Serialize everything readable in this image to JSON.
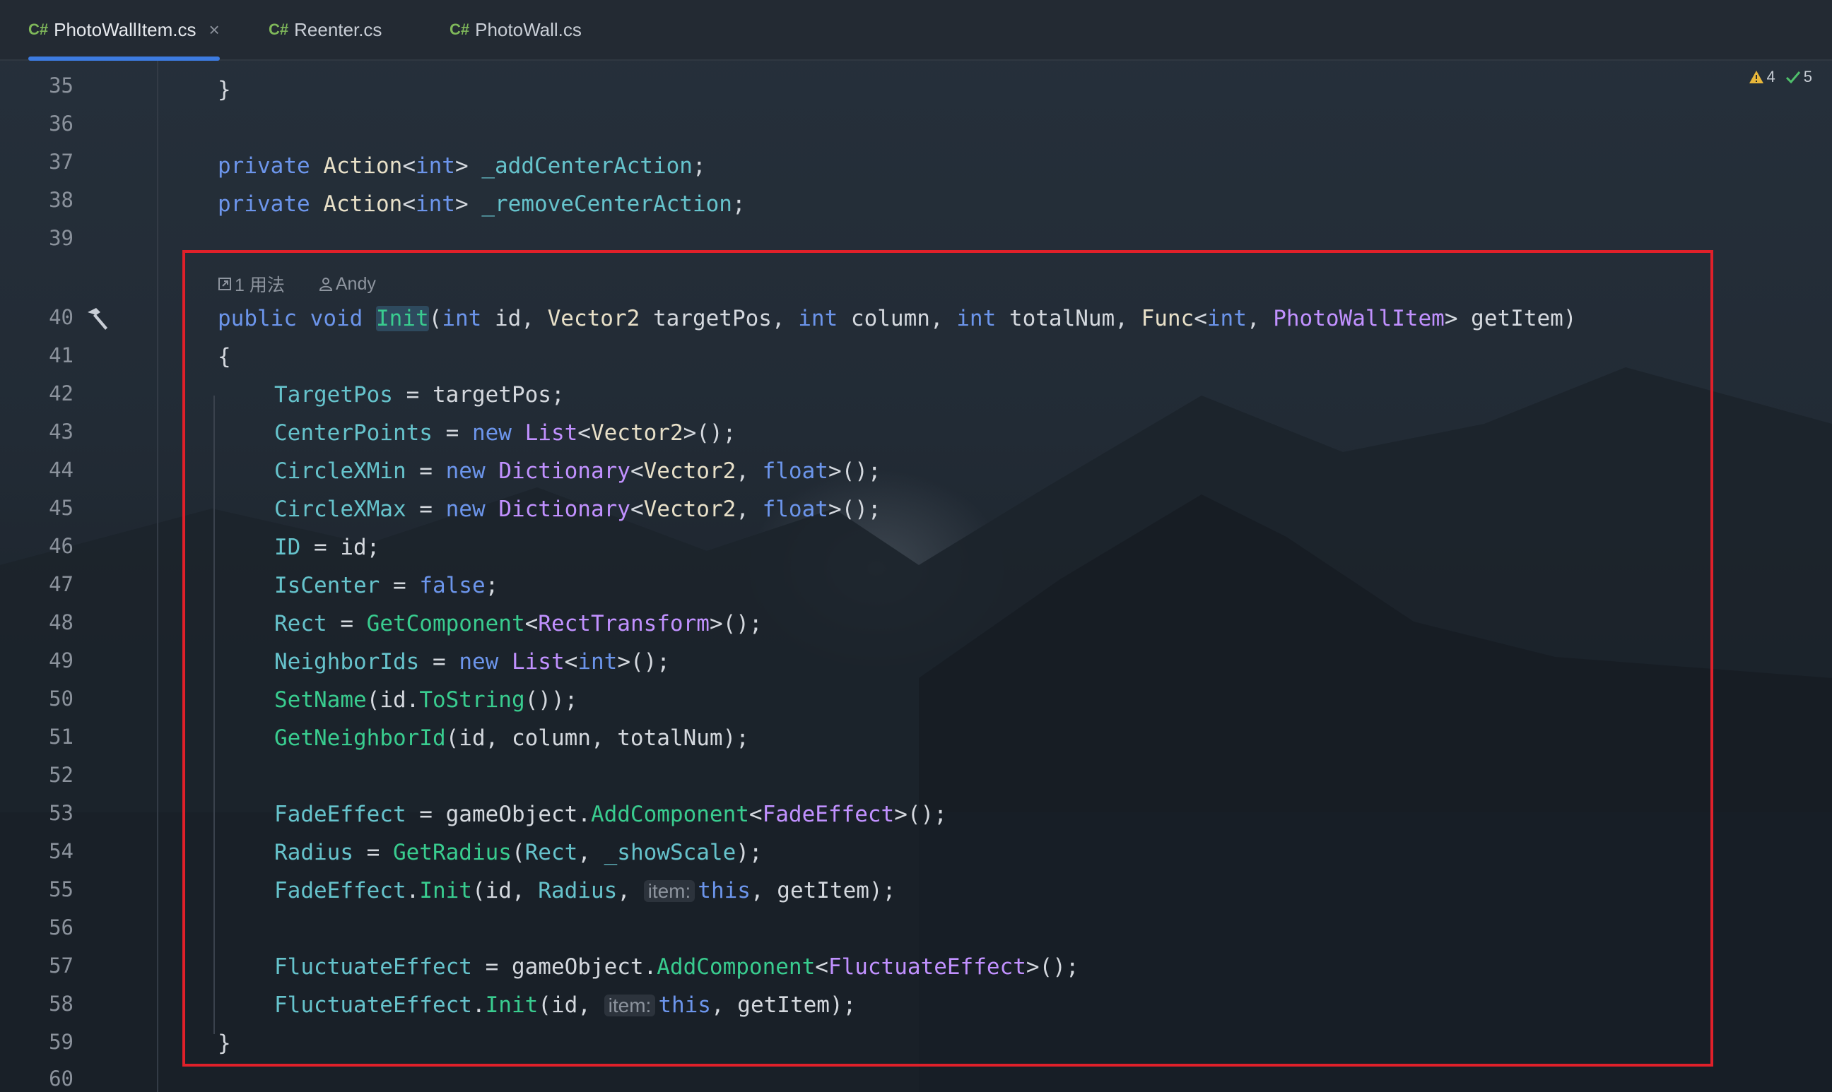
{
  "tabs": [
    {
      "lang": "C#",
      "label": "PhotoWallItem.cs",
      "active": true,
      "close": "×"
    },
    {
      "lang": "C#",
      "label": "Reenter.cs",
      "active": false
    },
    {
      "lang": "C#",
      "label": "PhotoWall.cs",
      "active": false
    }
  ],
  "status": {
    "warnings": "4",
    "ok": "5"
  },
  "gutter": {
    "line_numbers": [
      "35",
      "36",
      "37",
      "38",
      "39",
      "40",
      "41",
      "42",
      "43",
      "44",
      "45",
      "46",
      "47",
      "48",
      "49",
      "50",
      "51",
      "52",
      "53",
      "54",
      "55",
      "56",
      "57",
      "58",
      "59",
      "60"
    ]
  },
  "code_meta": {
    "usages": "1 用法",
    "author": "Andy"
  },
  "code": {
    "l35": "}",
    "l37": {
      "kw": "private",
      "type": "Action",
      "lt": "<",
      "arg": "int",
      "gt": ">",
      "name": "_addCenterAction",
      "end": ";"
    },
    "l38": {
      "kw": "private",
      "type": "Action",
      "lt": "<",
      "arg": "int",
      "gt": ">",
      "name": "_removeCenterAction",
      "end": ";"
    },
    "l40": {
      "kw1": "public",
      "kw2": "void",
      "fn": "Init",
      "p0": "(",
      "t1": "int",
      "a1": " id, ",
      "t2": "Vector2",
      "a2": " targetPos, ",
      "t3": "int",
      "a3": " column, ",
      "t4": "int",
      "a4": " totalNum, ",
      "t5": "Func",
      "t5b": "<",
      "t6": "int",
      "t6b": ", ",
      "t7": "PhotoWallItem",
      "a7": "> getItem)"
    },
    "l41": "{",
    "l42": {
      "prop": "TargetPos",
      "rest": " = targetPos;"
    },
    "l43": {
      "prop": "CenterPoints",
      "eq": " = ",
      "kw": "new",
      "cls": "List",
      "lt": "<",
      "t": "Vector2",
      "end": ">();"
    },
    "l44": {
      "prop": "CircleXMin",
      "eq": " = ",
      "kw": "new",
      "cls": "Dictionary",
      "lt": "<",
      "t": "Vector2",
      "sep": ", ",
      "t2": "float",
      "end": ">();"
    },
    "l45": {
      "prop": "CircleXMax",
      "eq": " = ",
      "kw": "new",
      "cls": "Dictionary",
      "lt": "<",
      "t": "Vector2",
      "sep": ", ",
      "t2": "float",
      "end": ">();"
    },
    "l46": {
      "prop": "ID",
      "rest": " = id;"
    },
    "l47": {
      "prop": "IsCenter",
      "eq": " = ",
      "kw": "false",
      "end": ";"
    },
    "l48": {
      "prop": "Rect",
      "eq": " = ",
      "fn": "GetComponent",
      "lt": "<",
      "cls": "RectTransform",
      "end": ">();"
    },
    "l49": {
      "prop": "NeighborIds",
      "eq": " = ",
      "kw": "new",
      "cls": "List",
      "lt": "<",
      "t": "int",
      "end": ">();"
    },
    "l50": {
      "fn": "SetName",
      "a": "(id.",
      "fn2": "ToString",
      "end": "());"
    },
    "l51": {
      "fn": "GetNeighborId",
      "rest": "(id, column, totalNum);"
    },
    "l53": {
      "prop": "FadeEffect",
      "eq": " = gameObject.",
      "fn": "AddComponent",
      "lt": "<",
      "cls": "FadeEffect",
      "end": ">();"
    },
    "l54": {
      "prop": "Radius",
      "eq": " = ",
      "fn": "GetRadius",
      "a": "(",
      "p2": "Rect",
      "b": ", ",
      "f": "_showScale",
      "end": ");"
    },
    "l55": {
      "prop": "FadeEffect",
      "dot": ".",
      "fn": "Init",
      "a": "(id, ",
      "p2": "Radius",
      "b": ", ",
      "hint": "item:",
      "kw": "this",
      "end": ", getItem);"
    },
    "l57": {
      "prop": "FluctuateEffect",
      "eq": " = gameObject.",
      "fn": "AddComponent",
      "lt": "<",
      "cls": "FluctuateEffect",
      "end": ">();"
    },
    "l58": {
      "prop": "FluctuateEffect",
      "dot": ".",
      "fn": "Init",
      "a": "(id, ",
      "hint": "item:",
      "kw": "this",
      "end": ", getItem);"
    },
    "l59": "}"
  },
  "colors": {
    "highlight_box": "#e0202a",
    "keyword": "#6c95eb",
    "class": "#c191ff",
    "property": "#66c3cc",
    "method": "#39cc8f",
    "tab_accent": "#3d7be0"
  }
}
